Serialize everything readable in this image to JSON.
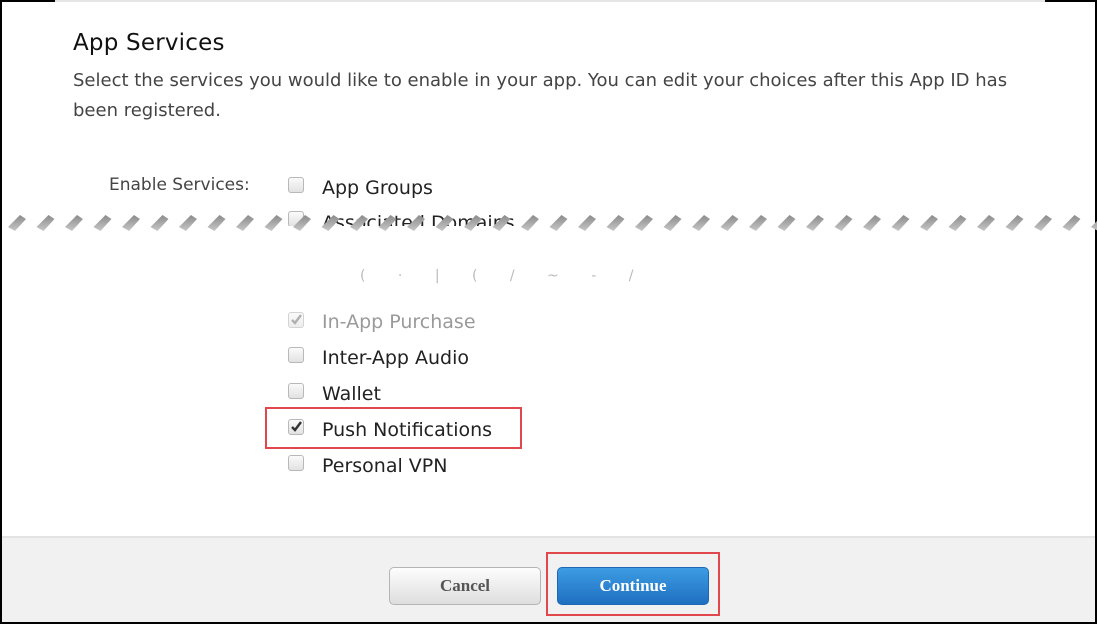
{
  "section": {
    "title": "App Services",
    "description": "Select the services you would like to enable in your app. You can edit your choices after this App ID has been registered."
  },
  "enable_services_label": "Enable Services:",
  "services": [
    {
      "label": "App Groups",
      "checked": false,
      "disabled": false
    },
    {
      "label": "Associated Domains",
      "checked": false,
      "disabled": false,
      "partially_hidden": true
    },
    {
      "label": "In-App Purchase",
      "checked": true,
      "disabled": true
    },
    {
      "label": "Inter-App Audio",
      "checked": false,
      "disabled": false
    },
    {
      "label": "Wallet",
      "checked": false,
      "disabled": false
    },
    {
      "label": "Push Notifications",
      "checked": true,
      "disabled": false,
      "highlighted": true
    },
    {
      "label": "Personal VPN",
      "checked": false,
      "disabled": false
    }
  ],
  "footer": {
    "cancel_label": "Cancel",
    "continue_label": "Continue"
  },
  "colors": {
    "highlight": "#e0484d",
    "primary_button": "#2a82d3",
    "footer_bg": "#f1f1f1"
  }
}
